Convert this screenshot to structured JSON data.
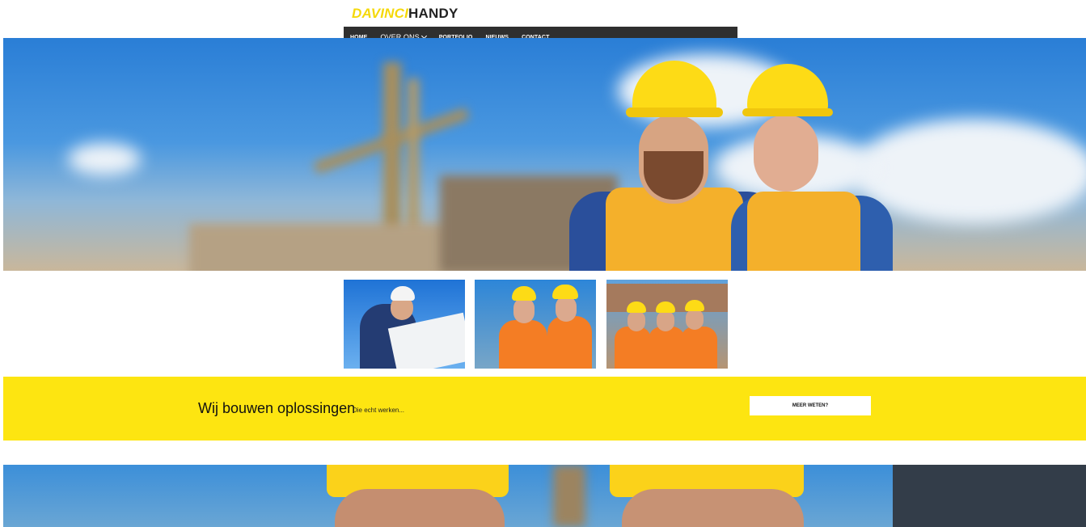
{
  "logo": {
    "part1": "DAVINCI",
    "part2": "HANDY"
  },
  "nav": {
    "items": [
      {
        "label": "HOME"
      },
      {
        "label": "OVER ONS"
      },
      {
        "label": "PORTFOLIO"
      },
      {
        "label": "NIEUWS"
      },
      {
        "label": "CONTACT"
      }
    ]
  },
  "banner": {
    "title": "Wij bouwen oplossingen",
    "subtitle": "Die echt werken...",
    "button_label": "MEER WETEN?"
  },
  "colors": {
    "brand_yellow": "#fde511",
    "nav_bg": "#2f2f2f",
    "logo_yellow": "#f5d90a"
  }
}
